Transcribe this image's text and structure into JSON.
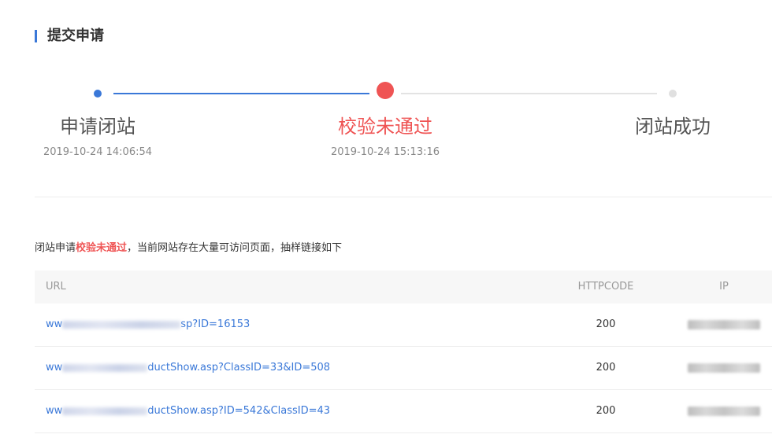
{
  "header": {
    "title": "提交申请"
  },
  "steps": [
    {
      "name": "申请闭站",
      "time": "2019-10-24 14:06:54",
      "state": "done"
    },
    {
      "name": "校验未通过",
      "time": "2019-10-24 15:13:16",
      "state": "error"
    },
    {
      "name": "闭站成功",
      "time": "",
      "state": "pending"
    }
  ],
  "notice": {
    "prefix": "闭站申请",
    "highlight": "校验未通过",
    "suffix": "，当前网站存在大量可访问页面，抽样链接如下"
  },
  "table": {
    "headers": {
      "url": "URL",
      "code": "HTTPCODE",
      "ip": "IP"
    },
    "rows": [
      {
        "url_start": "ww",
        "url_end": "sp?ID=16153",
        "code": "200"
      },
      {
        "url_start": "ww",
        "url_end": "ductShow.asp?ClassID=33&ID=508",
        "code": "200"
      },
      {
        "url_start": "ww",
        "url_end": "ductShow.asp?ID=542&ClassID=43",
        "code": "200"
      }
    ]
  },
  "colors": {
    "accent": "#3a78d8",
    "error": "#ef5454",
    "pending": "#e0e0e0"
  }
}
